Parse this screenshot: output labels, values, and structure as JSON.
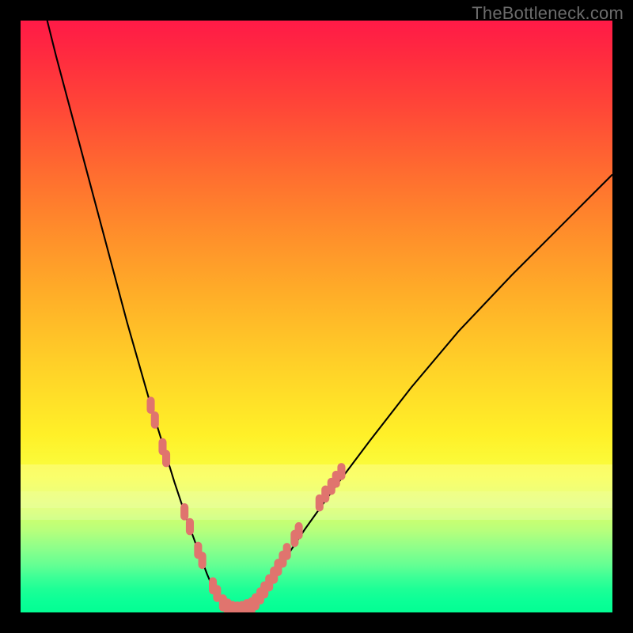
{
  "watermark": "TheBottleneck.com",
  "colors": {
    "background": "#000000",
    "curve_stroke": "#000000",
    "marker_fill": "#e0746e",
    "marker_stroke": "#e0746e"
  },
  "chart_data": {
    "type": "line",
    "title": "",
    "xlabel": "",
    "ylabel": "",
    "xlim": [
      0,
      100
    ],
    "ylim": [
      0,
      100
    ],
    "grid": false,
    "legend": false,
    "series": [
      {
        "name": "bottleneck-curve-left",
        "x": [
          4.5,
          6,
          8,
          10,
          12,
          14,
          16,
          18,
          20,
          22,
          24,
          26,
          28,
          30,
          31.5,
          33,
          34.5
        ],
        "values": [
          100,
          94,
          86.5,
          79,
          71.5,
          64,
          56.5,
          49,
          42,
          35,
          28.5,
          22,
          16,
          10.5,
          6.5,
          3,
          0.8
        ]
      },
      {
        "name": "bottleneck-curve-bottom",
        "x": [
          34.5,
          36,
          37.5,
          39
        ],
        "values": [
          0.8,
          0.4,
          0.4,
          0.8
        ]
      },
      {
        "name": "bottleneck-curve-right",
        "x": [
          39,
          41,
          44,
          48,
          53,
          59,
          66,
          74,
          83,
          92,
          100
        ],
        "values": [
          0.8,
          3.5,
          8,
          14,
          21,
          29,
          38,
          47.5,
          57,
          66,
          74
        ]
      }
    ],
    "markers": {
      "name": "highlighted-points",
      "points": [
        {
          "x": 22.0,
          "y": 35.0
        },
        {
          "x": 22.7,
          "y": 32.5
        },
        {
          "x": 24.0,
          "y": 28.0
        },
        {
          "x": 24.6,
          "y": 26.0
        },
        {
          "x": 27.7,
          "y": 17.0
        },
        {
          "x": 28.6,
          "y": 14.5
        },
        {
          "x": 30.0,
          "y": 10.5
        },
        {
          "x": 30.7,
          "y": 8.8
        },
        {
          "x": 32.5,
          "y": 4.5
        },
        {
          "x": 33.2,
          "y": 3.2
        },
        {
          "x": 34.2,
          "y": 1.6
        },
        {
          "x": 35.0,
          "y": 0.9
        },
        {
          "x": 35.8,
          "y": 0.5
        },
        {
          "x": 36.6,
          "y": 0.4
        },
        {
          "x": 37.4,
          "y": 0.5
        },
        {
          "x": 38.2,
          "y": 0.8
        },
        {
          "x": 39.0,
          "y": 1.1
        },
        {
          "x": 39.7,
          "y": 1.8
        },
        {
          "x": 40.5,
          "y": 2.8
        },
        {
          "x": 41.2,
          "y": 3.8
        },
        {
          "x": 42.0,
          "y": 5.0
        },
        {
          "x": 42.8,
          "y": 6.3
        },
        {
          "x": 43.5,
          "y": 7.6
        },
        {
          "x": 44.3,
          "y": 9.0
        },
        {
          "x": 45.0,
          "y": 10.3
        },
        {
          "x": 46.3,
          "y": 12.5
        },
        {
          "x": 47.0,
          "y": 13.8
        },
        {
          "x": 50.5,
          "y": 18.5
        },
        {
          "x": 51.5,
          "y": 20.0
        },
        {
          "x": 52.5,
          "y": 21.3
        },
        {
          "x": 53.3,
          "y": 22.5
        },
        {
          "x": 54.2,
          "y": 23.8
        }
      ]
    }
  }
}
